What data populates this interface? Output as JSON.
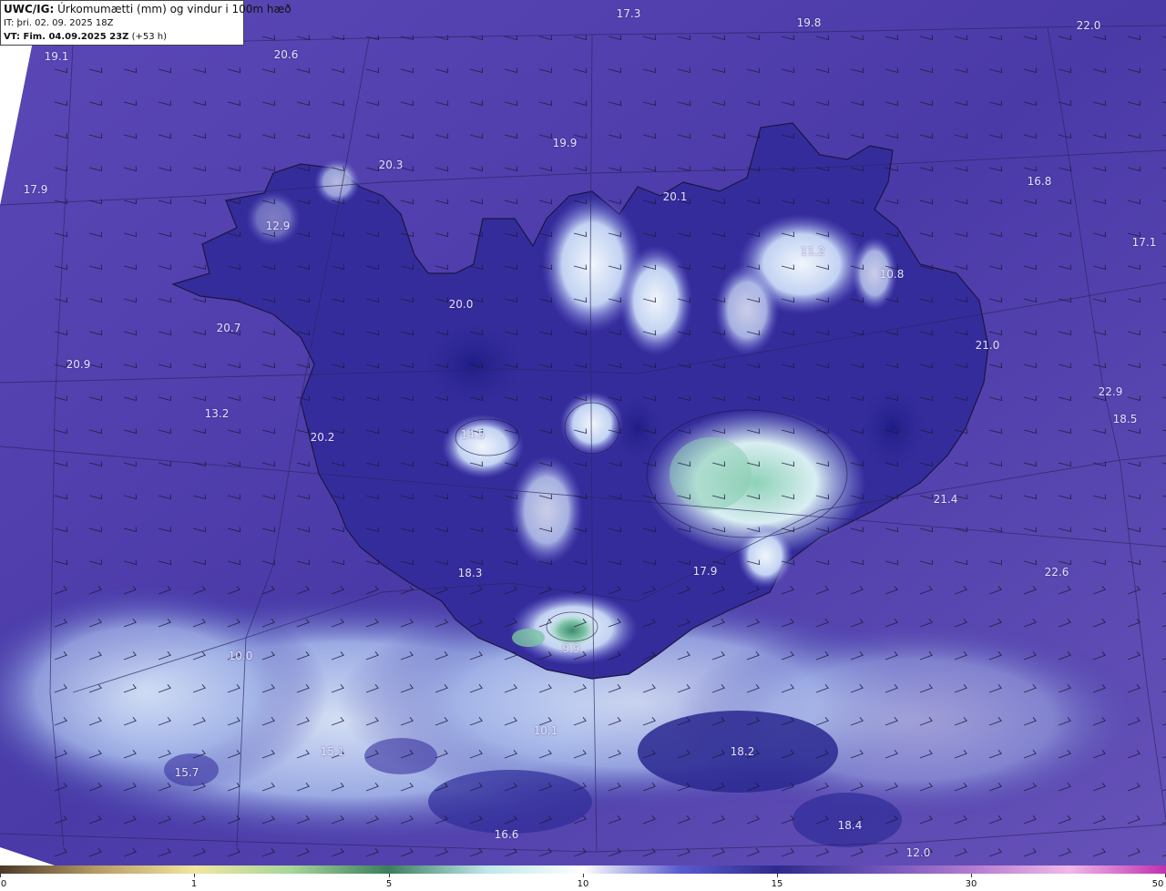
{
  "header": {
    "prefix": "UWC/IG:",
    "title": "Úrkomumætti (mm) og vindur i 100m hæð",
    "init_time": "IT: þri. 02. 09. 2025 18Z",
    "valid_prefix": "VT: Fim. 04.09.2025 23Z",
    "valid_suffix": "(+53 h)"
  },
  "map_values": [
    "17.3",
    "19.8",
    "22.0",
    "19.1",
    "20.6",
    "19.9",
    "20.3",
    "17.9",
    "20.1",
    "16.8",
    "12.9",
    "11.2",
    "17.1",
    "10.8",
    "20.0",
    "20.7",
    "21.0",
    "20.9",
    "22.9",
    "13.2",
    "18.5",
    "20.2",
    "14.5",
    "21.4",
    "18.3",
    "17.9",
    "22.6",
    "10.0",
    "9.9",
    "10.1",
    "15.1",
    "18.2",
    "15.7",
    "16.6",
    "18.4",
    "12.0"
  ],
  "colorbar": {
    "ticks": [
      "0",
      "1",
      "5",
      "10",
      "15",
      "30",
      "50"
    ],
    "colors": [
      "#4a3a2a",
      "#b79b63",
      "#f1e6a0",
      "#a7d59a",
      "#3c7d5d",
      "#bfe7ea",
      "#ffffff",
      "#5a5ad0",
      "#2e2a8c",
      "#6c52b8",
      "#b37ad0",
      "#f0b8e8",
      "#c030b0"
    ]
  },
  "colors": {
    "ocean": "#5a46b8",
    "land": "#3a2fa0",
    "precip_light": "#d2e2f7",
    "precip_heavy": "#6fbfa0"
  }
}
